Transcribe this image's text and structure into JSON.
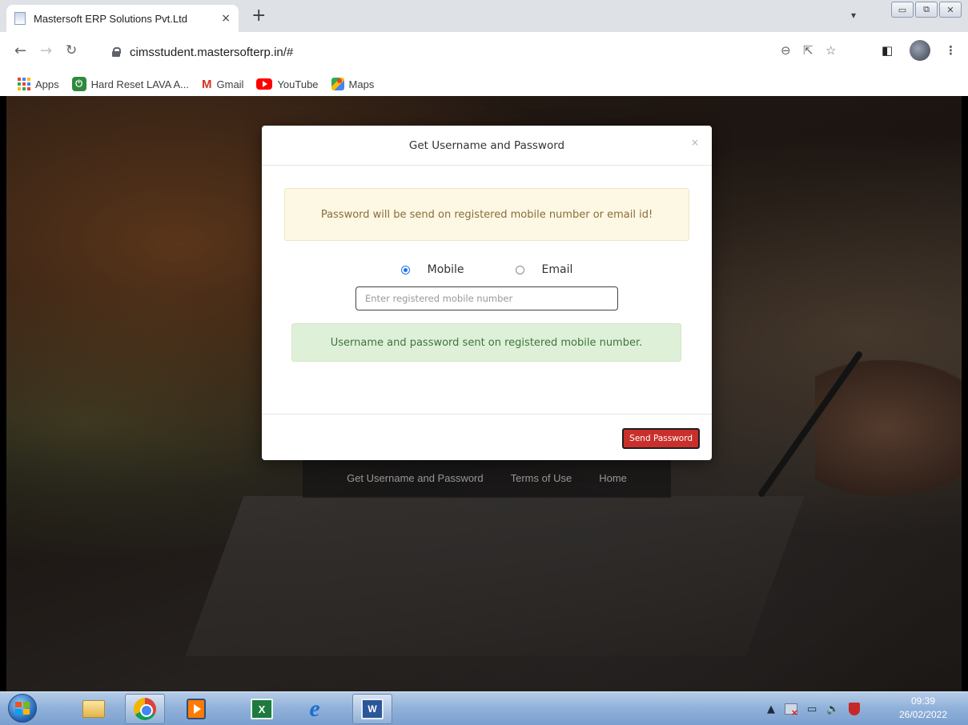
{
  "browser": {
    "tab_title": "Mastersoft ERP Solutions Pvt.Ltd",
    "tab_close": "×",
    "new_tab": "+",
    "url": "cimsstudent.mastersofterp.in/#",
    "bookmarks": [
      {
        "label": "Apps",
        "icon": "apps-grid-icon"
      },
      {
        "label": "Hard Reset LAVA A...",
        "icon": "hard-reset-icon"
      },
      {
        "label": "Gmail",
        "icon": "gmail-icon"
      },
      {
        "label": "YouTube",
        "icon": "youtube-icon"
      },
      {
        "label": "Maps",
        "icon": "maps-icon"
      }
    ]
  },
  "background_page": {
    "footer_links": [
      "Get Username and Password",
      "Terms of Use",
      "Home"
    ]
  },
  "modal": {
    "title": "Get Username and Password",
    "close": "×",
    "info_alert": "Password will be send on registered mobile number or email id!",
    "radio_options": [
      {
        "label": "Mobile",
        "checked": true
      },
      {
        "label": "Email",
        "checked": false
      }
    ],
    "mobile_placeholder": "Enter registered mobile number",
    "success_alert": "Username and password sent on registered mobile number.",
    "send_button": "Send Password"
  },
  "colors": {
    "alert_warning_bg": "#fcf8e3",
    "alert_success_bg": "#dff0d8",
    "send_button_bg": "#c9302c",
    "radio_checked": "#1a73e8"
  },
  "taskbar": {
    "time": "09:39",
    "date": "26/02/2022"
  }
}
